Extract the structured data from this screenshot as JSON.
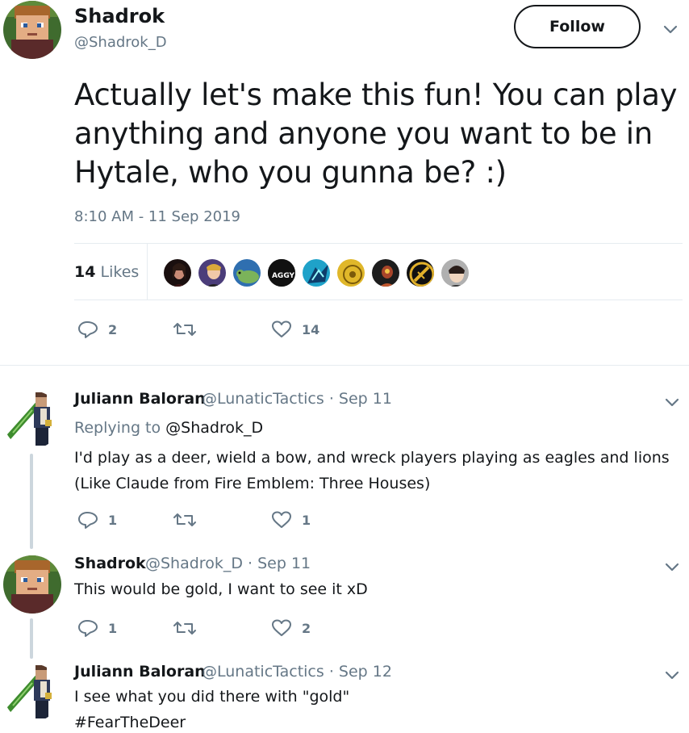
{
  "main_tweet": {
    "author_name": "Shadrok",
    "author_handle": "@Shadrok_D",
    "follow_label": "Follow",
    "text": "Actually let's make this fun! You can play anything and anyone you want to be in Hytale, who you gunna be? :)",
    "timestamp": "8:10 AM - 11 Sep 2019",
    "likes_count": "14",
    "likes_label": "Likes",
    "reply_count": "2",
    "like_count": "14",
    "likers": [
      "liker-1",
      "liker-2",
      "liker-3",
      "liker-4",
      "liker-5",
      "liker-6",
      "liker-7",
      "liker-8",
      "liker-9"
    ],
    "liker_badge_text": "AGGY"
  },
  "replies": [
    {
      "name": "Juliann Baloran",
      "handle": "@LunaticTactics",
      "date": "· Sep 11",
      "replying_prefix": "Replying to",
      "replying_to": "@Shadrok_D",
      "text_line1": "I'd play as a deer, wield a bow, and wreck players playing as eagles and lions",
      "text_line2": "(Like Claude from Fire Emblem: Three Houses)",
      "reply_count": "1",
      "like_count": "1"
    },
    {
      "name": "Shadrok",
      "handle": "@Shadrok_D",
      "date": "· Sep 11",
      "text_line1": "This would be gold, I want to see it xD",
      "reply_count": "1",
      "like_count": "2"
    },
    {
      "name": "Juliann Baloran",
      "handle": "@LunaticTactics",
      "date": "· Sep 12",
      "text_line1": "I see what you did there with \"gold\"",
      "text_line2": "#FearTheDeer"
    }
  ],
  "colors": {
    "text": "#14171a",
    "secondary": "#657786",
    "divider": "#e6ecf0",
    "thread_line": "#ccd6dd"
  },
  "icons": {
    "reply": "reply-icon",
    "retweet": "retweet-icon",
    "like": "heart-icon",
    "caret": "chevron-down-icon"
  }
}
